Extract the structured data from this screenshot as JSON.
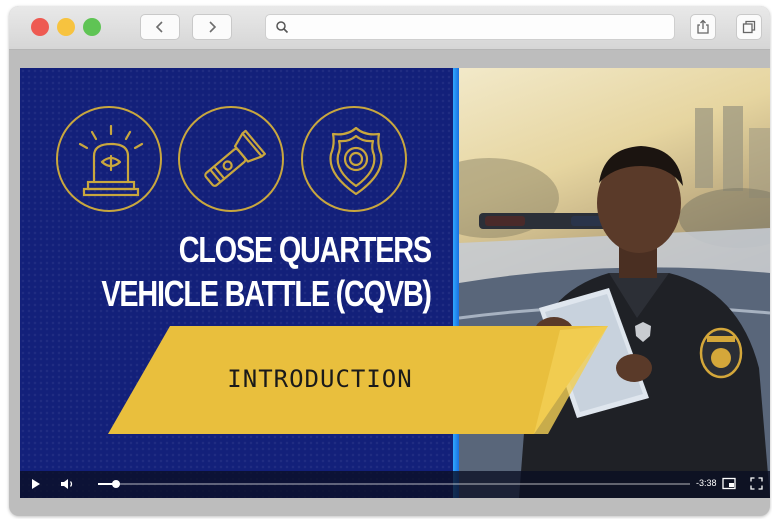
{
  "browser": {
    "url_value": "",
    "icons": {
      "close": "red-traffic-light",
      "minimize": "yellow-traffic-light",
      "maximize": "green-traffic-light",
      "back": "chevron-left-icon",
      "forward": "chevron-right-icon",
      "search": "search-icon",
      "share": "share-icon",
      "tabs": "tabs-icon"
    }
  },
  "video": {
    "title_line1": "CLOSE QUARTERS",
    "title_line2": "VEHICLE BATTLE (CQVB)",
    "chapter_label": "INTRODUCTION",
    "emblems": [
      "siren-icon",
      "flashlight-icon",
      "police-badge-icon"
    ],
    "photo": "police-officer-with-tablet",
    "colors": {
      "panel": "#13207a",
      "gold": "#e9bf3d",
      "emblem_line": "#c9a73e",
      "divider": "#2fa8ff"
    }
  },
  "player": {
    "time_remaining": "-3:38",
    "progress": 0.03,
    "icons": [
      "play-icon",
      "volume-icon",
      "picture-in-picture-icon",
      "fullscreen-icon"
    ]
  }
}
